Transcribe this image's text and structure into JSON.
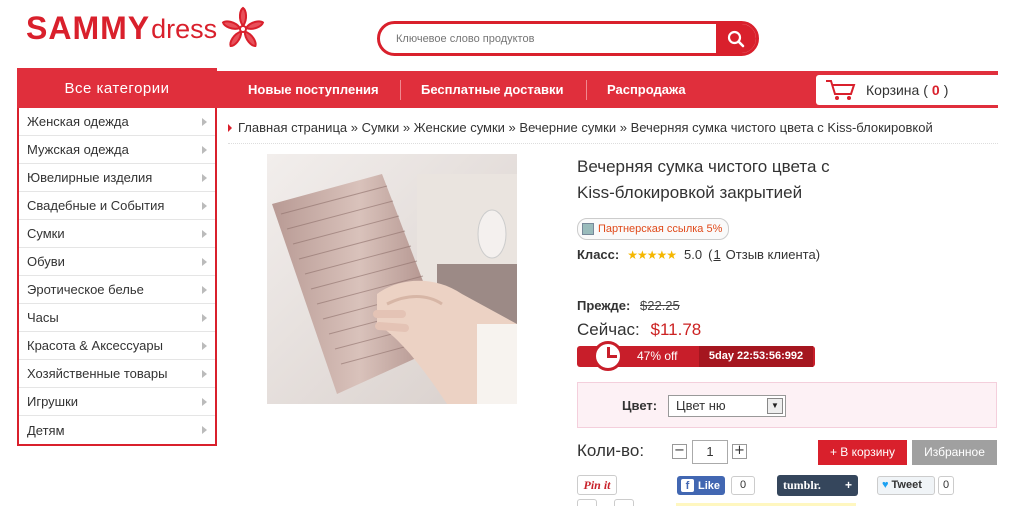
{
  "header": {
    "logo_text_bold": "SAMMY",
    "logo_text_light": "dress",
    "search_placeholder": "Ключевое слово продуктов"
  },
  "nav": {
    "items": [
      "Новые поступления",
      "Бесплатные доставки",
      "Распродажа"
    ],
    "cart_label": "Корзина",
    "cart_count": "0"
  },
  "sidebar": {
    "title": "Все категории",
    "items": [
      "Женская одежда",
      "Мужская одежда",
      "Ювелирные изделия",
      "Свадебные и События",
      "Сумки",
      "Обуви",
      "Эротическое белье",
      "Часы",
      "Красота & Аксессуары",
      "Хозяйственные товары",
      "Игрушки",
      "Детям"
    ]
  },
  "breadcrumb": {
    "text": "Главная страница » Сумки » Женские сумки » Вечерние сумки » Вечерняя сумка чистого цвета с Kiss-блокировкой"
  },
  "product": {
    "title_line1": "Вечерняя сумка чистого цвета с",
    "title_line2": "Kiss-блокировкой закрытией",
    "partner_link": "Партнерская ссылка 5%",
    "rating_label": "Класс:",
    "rating_value": "5.0",
    "reviews_open": "(",
    "reviews_count": "1",
    "reviews_text": "Отзыв клиента)",
    "stars": 5,
    "before_label": "Прежде:",
    "before_price": "$22.25",
    "now_label": "Сейчас:",
    "now_price": "$11.78",
    "discount": "47% off",
    "countdown": "5day 22:53:56:992",
    "color_label": "Цвет:",
    "color_value": "Цвет ню",
    "qty_label": "Коли-во:",
    "qty_value": "1",
    "add_to_cart": "+ В корзину",
    "favorite": "Избранное"
  },
  "social": {
    "pinterest": "Pin it",
    "fb_like": "Like",
    "fb_count": "0",
    "tumblr": "tumblr.",
    "tumblr_plus": "+",
    "tweet": "Tweet",
    "tweet_count": "0"
  },
  "colors": {
    "brand_red": "#d9202c",
    "nav_red": "#e02f3c",
    "price_red": "#c22222",
    "fb_blue": "#4267b2",
    "tumblr_navy": "#35465c"
  }
}
